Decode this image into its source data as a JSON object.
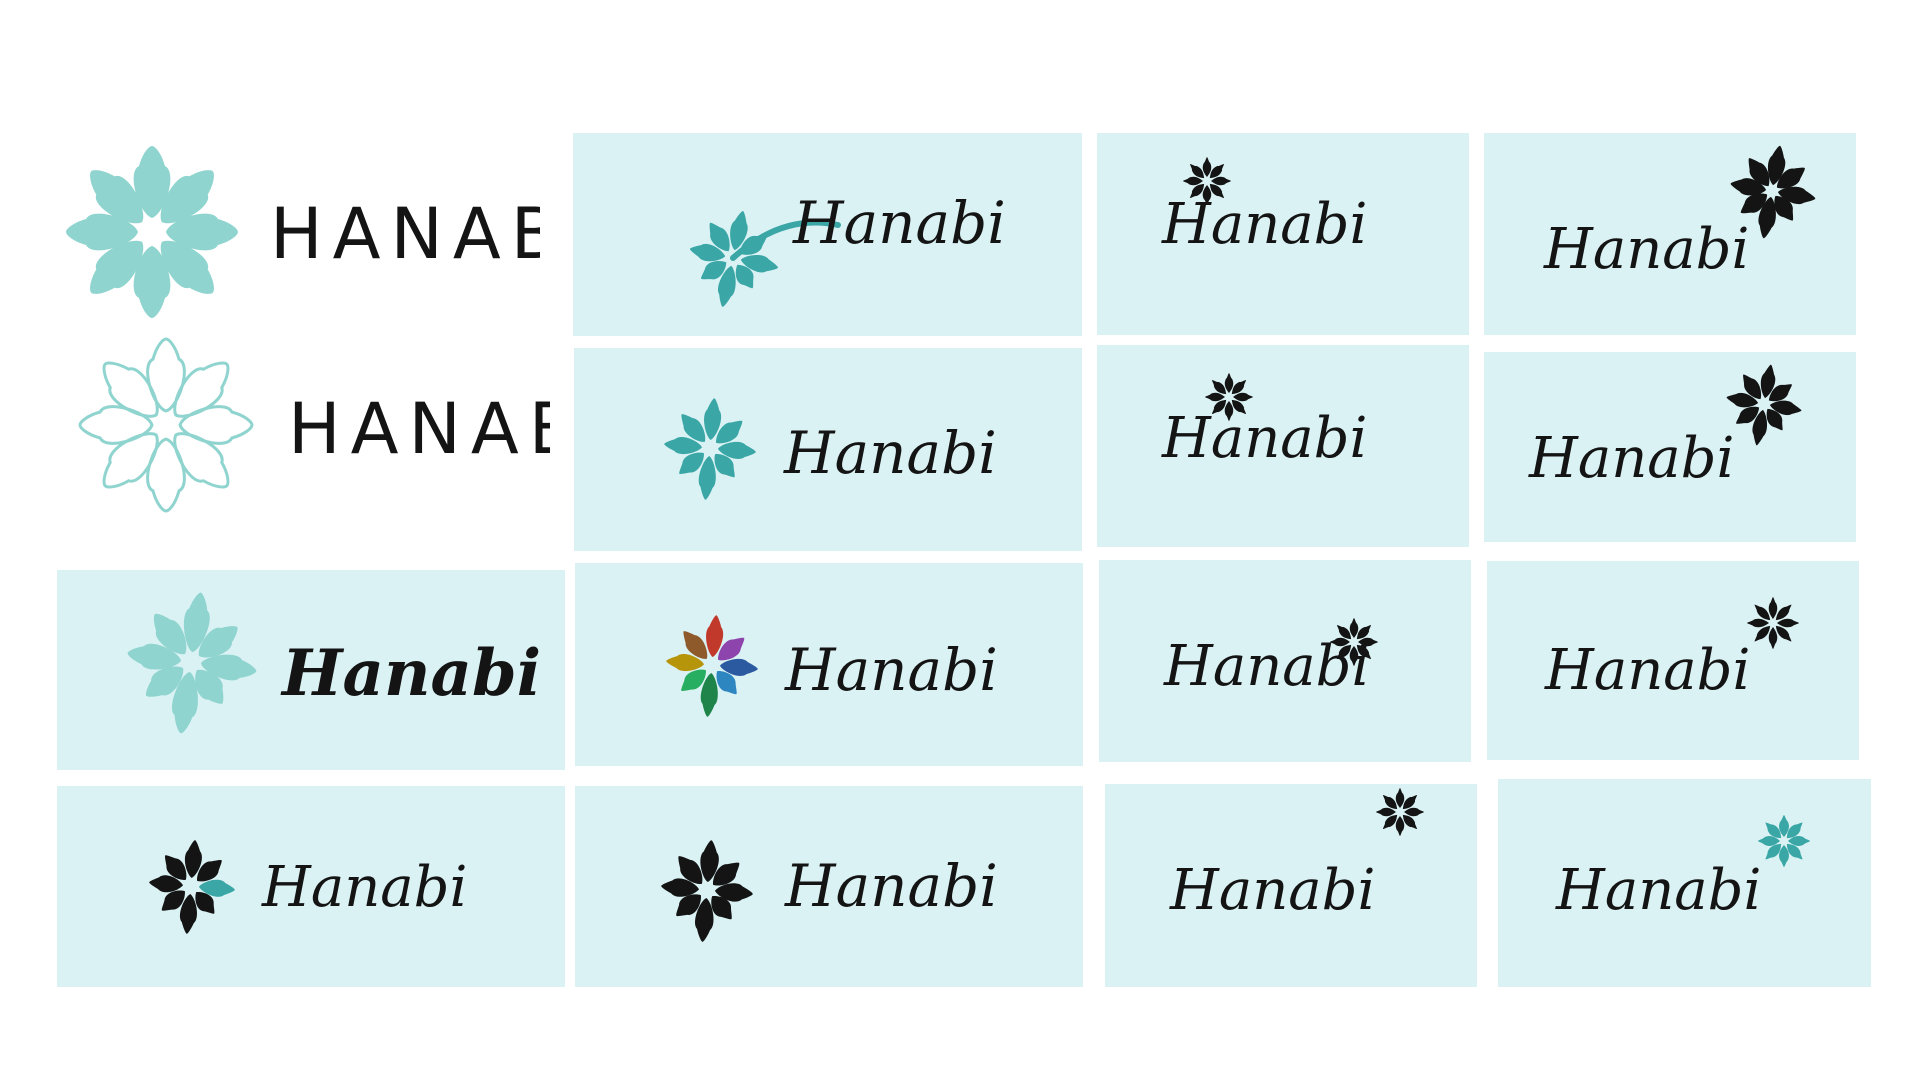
{
  "colors": {
    "background": "#ffffff",
    "panel": "#daf2f4",
    "teal": "#8fd4cf",
    "teal_dark": "#3aa6a6",
    "ink": "#141414"
  },
  "logos": [
    {
      "id": "caps-solid",
      "text": "HANABI",
      "icon": "teal-solid-burst-icon"
    },
    {
      "id": "caps-outline",
      "text": "HANABI",
      "icon": "teal-outline-burst-icon"
    },
    {
      "id": "bold-teal",
      "text": "Hanabi",
      "icon": "large-teal-burst-icon"
    },
    {
      "id": "teal-swoosh",
      "text": "Hanabi",
      "icon": "teal-burst-swoosh-icon"
    },
    {
      "id": "teal-burst",
      "text": "Hanabi",
      "icon": "teal-burst-icon"
    },
    {
      "id": "rainbow-burst",
      "text": "Hanabi",
      "icon": "rainbow-burst-icon"
    },
    {
      "id": "black-burst-small",
      "text": "Hanabi",
      "icon": "black-burst-teal-tip-icon"
    },
    {
      "id": "black-burst",
      "text": "Hanabi",
      "icon": "black-burst-icon"
    },
    {
      "id": "burst-over-h-1",
      "text": "Hanabi",
      "icon": "small-black-burst-icon"
    },
    {
      "id": "burst-over-h-2",
      "text": "Hanabi",
      "icon": "small-black-burst-icon"
    },
    {
      "id": "burst-in-b",
      "text": "Hanabi",
      "icon": "small-black-burst-icon"
    },
    {
      "id": "burst-top-right",
      "text": "Hanabi",
      "icon": "small-black-burst-icon"
    },
    {
      "id": "burst-big-over-i-1",
      "text": "Hanabi",
      "icon": "large-black-burst-icon"
    },
    {
      "id": "burst-big-over-i-2",
      "text": "Hanabi",
      "icon": "large-black-burst-icon"
    },
    {
      "id": "burst-small-over-i",
      "text": "Hanabi",
      "icon": "small-black-burst-icon"
    },
    {
      "id": "burst-teal-over-i",
      "text": "Hanabi",
      "icon": "small-teal-burst-icon"
    }
  ]
}
